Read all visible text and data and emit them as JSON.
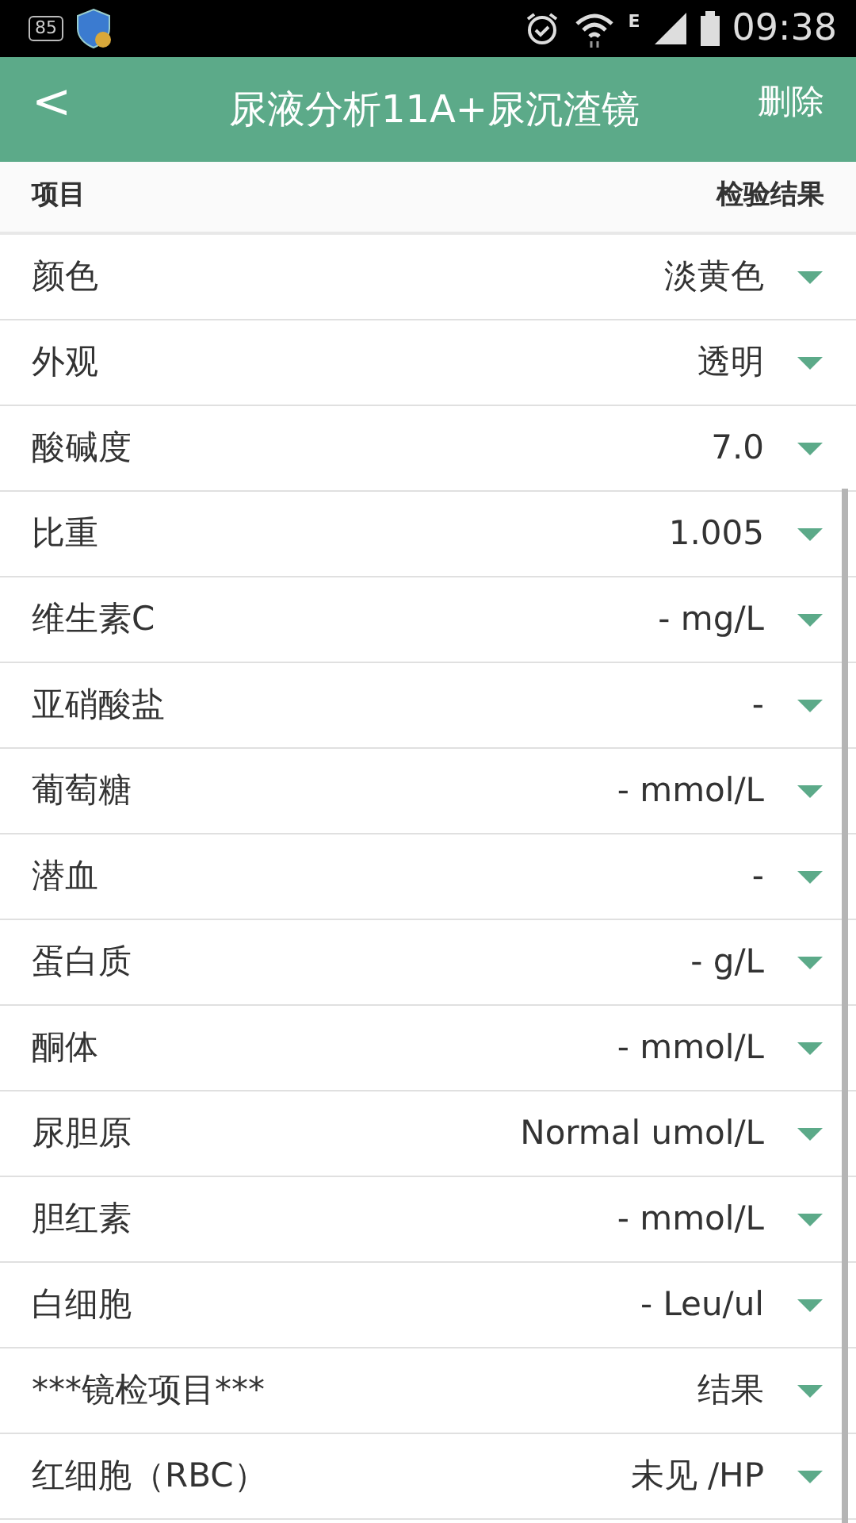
{
  "status_bar": {
    "notification_badge": "85",
    "network_type": "E",
    "time": "09:38"
  },
  "header": {
    "back": "<",
    "title": "尿液分析11A+尿沉渣镜",
    "action": "删除"
  },
  "columns": [
    "项目",
    "检验结果"
  ],
  "rows": [
    {
      "name": "颜色",
      "value": "淡黄色"
    },
    {
      "name": "外观",
      "value": "透明"
    },
    {
      "name": "酸碱度",
      "value": "7.0"
    },
    {
      "name": "比重",
      "value": "1.005"
    },
    {
      "name": "维生素C",
      "value": "- mg/L"
    },
    {
      "name": "亚硝酸盐",
      "value": "-"
    },
    {
      "name": "葡萄糖",
      "value": "- mmol/L"
    },
    {
      "name": "潜血",
      "value": "-"
    },
    {
      "name": "蛋白质",
      "value": "- g/L"
    },
    {
      "name": "酮体",
      "value": "- mmol/L"
    },
    {
      "name": "尿胆原",
      "value": "Normal umol/L"
    },
    {
      "name": "胆红素",
      "value": "- mmol/L"
    },
    {
      "name": "白细胞",
      "value": "- Leu/ul"
    },
    {
      "name": "***镜检项目***",
      "value": "结果"
    },
    {
      "name": "红细胞（RBC）",
      "value": "未见 /HP"
    }
  ]
}
